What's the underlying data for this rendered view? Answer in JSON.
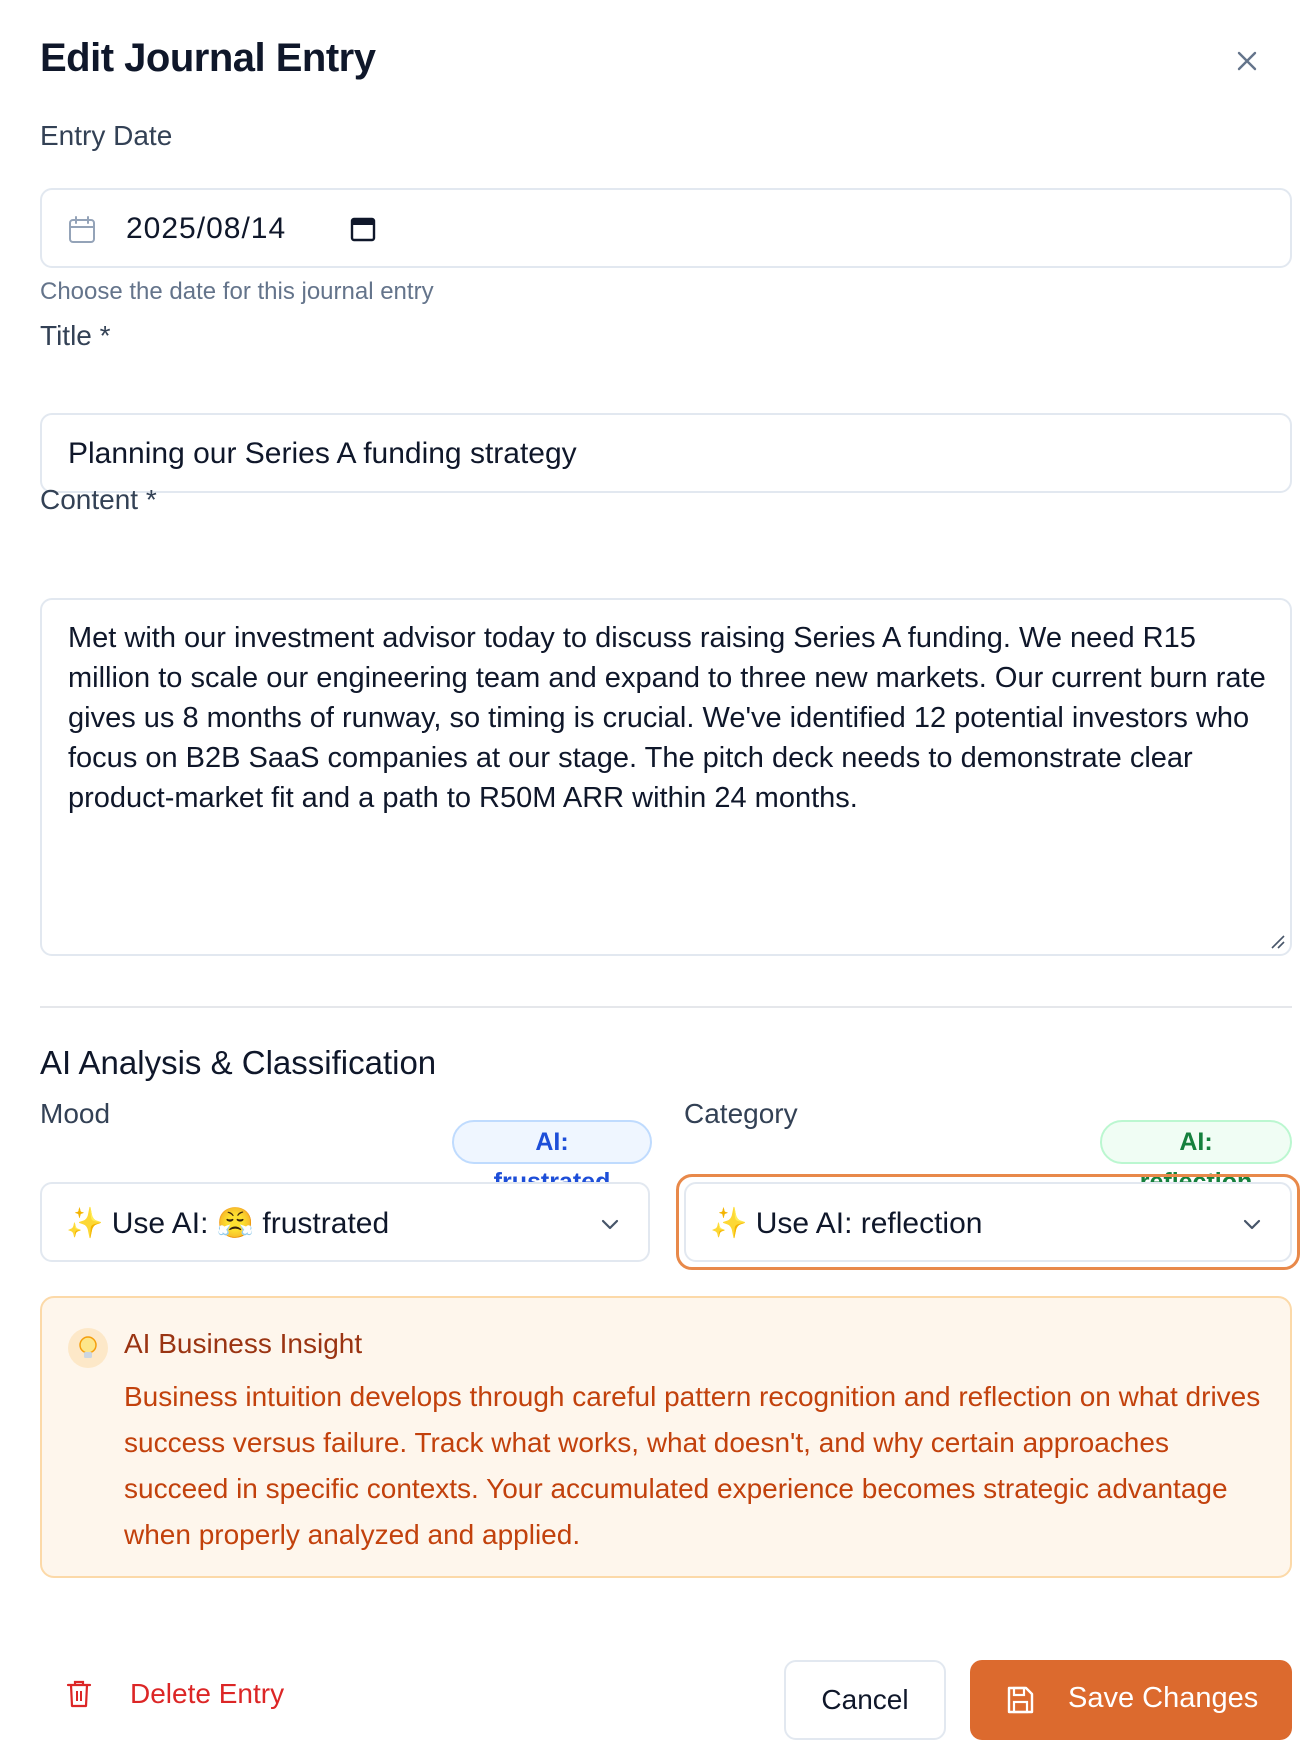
{
  "dialog": {
    "title": "Edit Journal Entry"
  },
  "entry_date": {
    "label": "Entry Date",
    "value": "2025/08/14",
    "help": "Choose the date for this journal entry"
  },
  "title_field": {
    "label": "Title *",
    "value": "Planning our Series A funding strategy"
  },
  "content_field": {
    "label": "Content *",
    "value": "Met with our investment advisor today to discuss raising Series A funding. We need R15 million to scale our engineering team and expand to three new markets. Our current burn rate gives us 8 months of runway, so timing is crucial. We've identified 12 potential investors who focus on B2B SaaS companies at our stage. The pitch deck needs to demonstrate clear product-market fit and a path to R50M ARR within 24 months."
  },
  "ai_section": {
    "title": "AI Analysis & Classification",
    "mood": {
      "label": "Mood",
      "badge": "AI: frustrated",
      "selected": "✨ Use AI: 😤 frustrated"
    },
    "category": {
      "label": "Category",
      "badge": "AI: reflection",
      "selected": "✨ Use AI: reflection"
    }
  },
  "insight": {
    "title": "AI Business Insight",
    "body": "Business intuition develops through careful pattern recognition and reflection on what drives success versus failure. Track what works, what doesn't, and why certain approaches succeed in specific contexts. Your accumulated experience becomes strategic advantage when properly analyzed and applied."
  },
  "actions": {
    "delete_label": "Delete Entry",
    "cancel_label": "Cancel",
    "save_label": "Save Changes"
  },
  "colors": {
    "accent": "#dc6a2e",
    "danger": "#dc2626",
    "mood_badge": "#1d4ed8",
    "category_badge": "#15803d"
  }
}
